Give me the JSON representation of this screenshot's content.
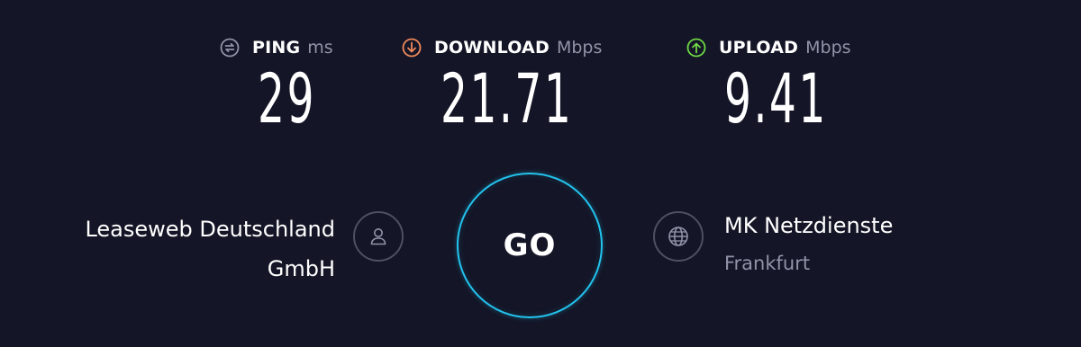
{
  "metrics": {
    "ping": {
      "label": "PING",
      "unit": "ms",
      "value": "29",
      "icon": "ping-icon",
      "color": "#9193a8"
    },
    "download": {
      "label": "DOWNLOAD",
      "unit": "Mbps",
      "value": "21.71",
      "icon": "download-arrow-icon",
      "color": "#f08a5d"
    },
    "upload": {
      "label": "UPLOAD",
      "unit": "Mbps",
      "value": "9.41",
      "icon": "upload-arrow-icon",
      "color": "#6fd846"
    }
  },
  "isp": {
    "name_line1": "Leaseweb Deutschland",
    "name_line2": "GmbH",
    "icon": "user-icon"
  },
  "server": {
    "name": "MK Netzdienste",
    "location": "Frankfurt",
    "icon": "globe-icon"
  },
  "go_button": {
    "label": "GO",
    "ring_color": "#22c3ee"
  },
  "colors": {
    "background": "#141526",
    "muted_text": "#9193a8",
    "icon_border": "#4d5063"
  }
}
